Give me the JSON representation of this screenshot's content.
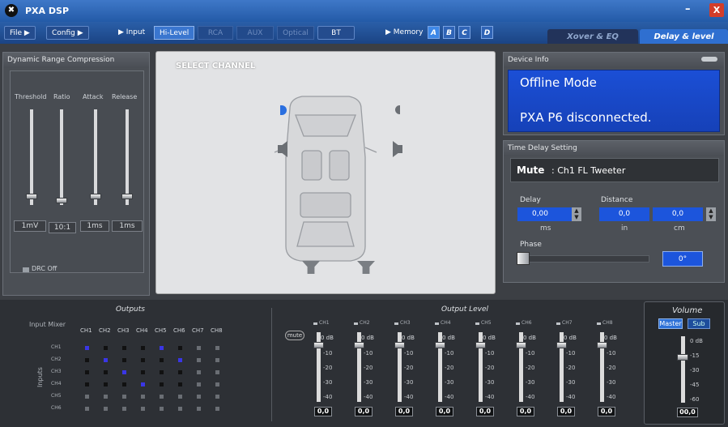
{
  "app": {
    "title": "PXA DSP",
    "minimize": "–",
    "close": "X"
  },
  "menu": {
    "file": "File",
    "config": "Config",
    "input": "Input",
    "inputs": [
      "Hi-Level",
      "RCA",
      "AUX",
      "Optical",
      "BT"
    ],
    "memory": "Memory",
    "memory_slots": [
      "A",
      "B",
      "C",
      "D"
    ],
    "tabs": [
      "Xover & EQ",
      "Delay & level"
    ]
  },
  "drc": {
    "title": "Dynamic Range Compression",
    "labels": [
      "Threshold",
      "Ratio",
      "Attack",
      "Release"
    ],
    "values": [
      "1mV",
      "10:1",
      "1ms",
      "1ms"
    ],
    "toggle": "DRC Off"
  },
  "center": {
    "title": "SELECT CHANNEL"
  },
  "device": {
    "title": "Device Info",
    "line1": "Offline Mode",
    "line2": "PXA P6 disconnected."
  },
  "delay": {
    "title": "Time Delay Setting",
    "mute_label": "Mute",
    "channel": ": Ch1  FL Tweeter",
    "delay_label": "Delay",
    "distance_label": "Distance",
    "delay_value": "0,00",
    "distance_in": "0,0",
    "distance_cm": "0,0",
    "unit_ms": "ms",
    "unit_in": "in",
    "unit_cm": "cm",
    "phase_label": "Phase",
    "phase_value": "0°"
  },
  "mixer": {
    "outputs_title": "Outputs",
    "input_mixer": "Input Mixer",
    "inputs_label": "Inputs",
    "cols": [
      "CH1",
      "CH2",
      "CH3",
      "CH4",
      "CH5",
      "CH6",
      "CH7",
      "CH8"
    ],
    "rows": [
      "CH1",
      "CH2",
      "CH3",
      "CH4",
      "CH5",
      "CH6"
    ]
  },
  "output_level": {
    "title": "Output Level",
    "mute": "mute",
    "channels": [
      "CH1",
      "CH2",
      "CH3",
      "CH4",
      "CH5",
      "CH6",
      "CH7",
      "CH8"
    ],
    "top_label": "0 dB",
    "ticks": [
      "-10",
      "-20",
      "-30",
      "-40"
    ],
    "values": [
      "0,0",
      "0,0",
      "0,0",
      "0,0",
      "0,0",
      "0,0",
      "0,0",
      "0,0"
    ]
  },
  "volume": {
    "title": "Volume",
    "master": "Master",
    "sub": "Sub",
    "ticks": [
      "0 dB",
      "-15",
      "-30",
      "-45",
      "-60"
    ],
    "value": "00,0"
  }
}
